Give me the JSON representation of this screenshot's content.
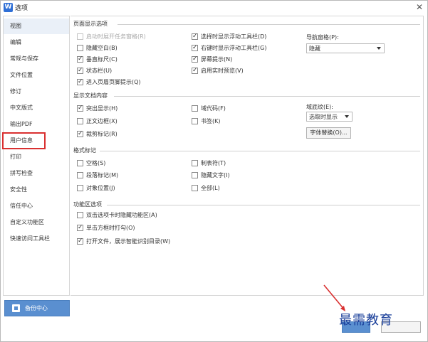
{
  "window": {
    "title": "选项",
    "app_icon": "W"
  },
  "sidebar": {
    "items": [
      {
        "label": "视图"
      },
      {
        "label": "编辑"
      },
      {
        "label": "常规与保存"
      },
      {
        "label": "文件位置"
      },
      {
        "label": "修订"
      },
      {
        "label": "中文版式"
      },
      {
        "label": "输出PDF"
      },
      {
        "label": "用户信息"
      },
      {
        "label": "打印"
      },
      {
        "label": "拼写检查"
      },
      {
        "label": "安全性"
      },
      {
        "label": "信任中心"
      },
      {
        "label": "自定义功能区"
      },
      {
        "label": "快速访问工具栏"
      }
    ],
    "backup_label": "备份中心"
  },
  "sections": {
    "page_display": {
      "title": "页面显示选项",
      "left": [
        {
          "label": "启动时展开任务窗格(R)",
          "checked": false,
          "disabled": true
        },
        {
          "label": "隐藏空白(B)",
          "checked": false
        },
        {
          "label": "垂直标尺(C)",
          "checked": true
        },
        {
          "label": "状态栏(U)",
          "checked": true
        },
        {
          "label": "进入页眉页脚提示(Q)",
          "checked": true
        }
      ],
      "right": [
        {
          "label": "选择时显示浮动工具栏(D)",
          "checked": true
        },
        {
          "label": "右键时显示浮动工具栏(G)",
          "checked": true
        },
        {
          "label": "屏幕提示(N)",
          "checked": true
        },
        {
          "label": "启用实时预览(V)",
          "checked": true
        }
      ],
      "nav_pane_label": "导航窗格(P):",
      "nav_pane_value": "隐藏"
    },
    "doc_content": {
      "title": "显示文档内容",
      "left": [
        {
          "label": "突出显示(H)",
          "checked": true
        },
        {
          "label": "正文边框(X)",
          "checked": false
        },
        {
          "label": "裁剪标记(R)",
          "checked": true
        }
      ],
      "right": [
        {
          "label": "域代码(F)",
          "checked": false
        },
        {
          "label": "书签(K)",
          "checked": false
        }
      ],
      "field_shading_label": "域底纹(E):",
      "field_shading_value": "选取时显示",
      "font_sub_button": "字体替换(O)..."
    },
    "format_marks": {
      "title": "格式标记",
      "left": [
        {
          "label": "空格(S)",
          "checked": false
        },
        {
          "label": "段落标记(M)",
          "checked": false
        },
        {
          "label": "对象位置(J)",
          "checked": false
        }
      ],
      "right": [
        {
          "label": "制表符(T)",
          "checked": false
        },
        {
          "label": "隐藏文字(I)",
          "checked": false
        },
        {
          "label": "全部(L)",
          "checked": false
        }
      ]
    },
    "ribbon": {
      "title": "功能区选项",
      "items": [
        {
          "label": "双击选项卡时隐藏功能区(A)",
          "checked": false
        },
        {
          "label": "单击方框时打勾(O)",
          "checked": true
        },
        {
          "label": "打开文件，展示智能识别目录(W)",
          "checked": true
        }
      ]
    }
  },
  "watermark": "最需教育",
  "colors": {
    "accent": "#5a8fd0",
    "highlight": "#d93030",
    "watermark": "#1a3f9a"
  }
}
